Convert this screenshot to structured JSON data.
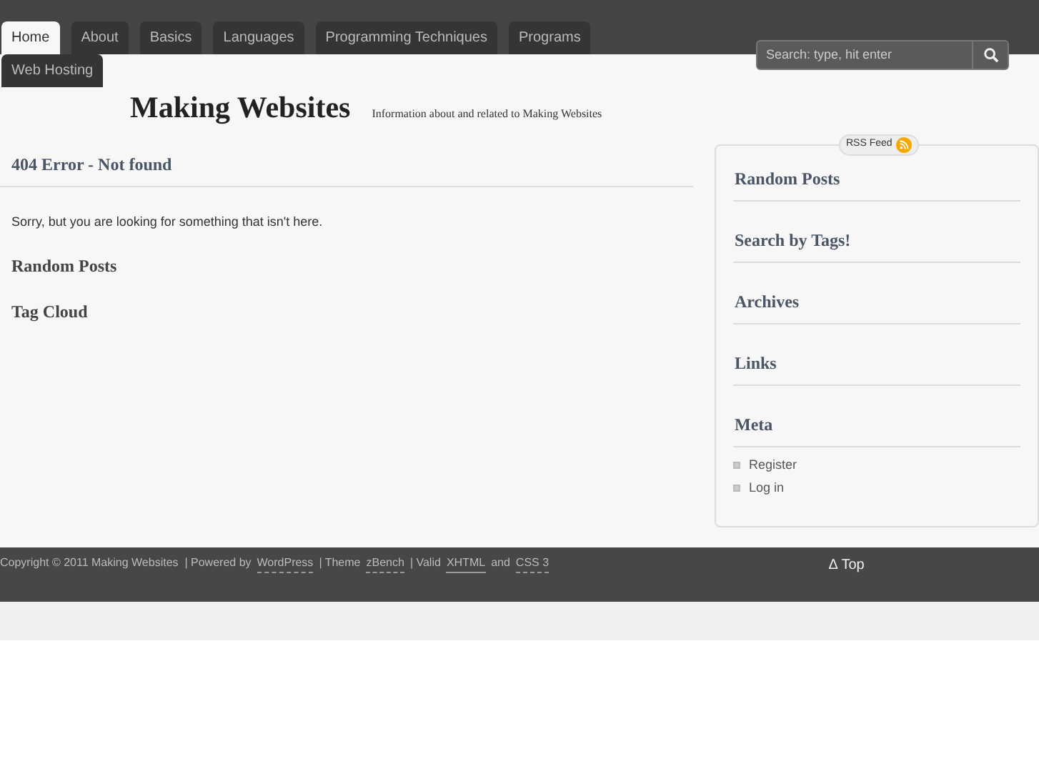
{
  "tabs": [
    {
      "label": "Home",
      "selected": true
    },
    {
      "label": "About",
      "selected": false
    },
    {
      "label": "Basics",
      "selected": false
    },
    {
      "label": "Languages",
      "selected": false
    },
    {
      "label": "Programming Techniques",
      "selected": false
    },
    {
      "label": "Programs",
      "selected": false
    },
    {
      "label": "Web Hosting",
      "selected": false
    }
  ],
  "search": {
    "placeholder": "Search: type, hit enter"
  },
  "site": {
    "title": "Making Websites",
    "tagline": "Information about and related to Making Websites"
  },
  "main": {
    "title": "404 Error - Not found",
    "message": "Sorry, but you are looking for something that isn't here.",
    "sections": [
      "Random Posts",
      "Tag Cloud"
    ]
  },
  "sidebar": {
    "rss": "RSS Feed",
    "widgets": [
      {
        "title": "Random Posts"
      },
      {
        "title": "Search by Tags!"
      },
      {
        "title": "Archives"
      },
      {
        "title": "Links"
      },
      {
        "title": "Meta",
        "items": [
          "Register",
          "Log in"
        ]
      }
    ]
  },
  "footer": {
    "parts": [
      {
        "kind": "text",
        "text": "Copyright © 2011 Making Websites  | Powered by"
      },
      {
        "kind": "link",
        "text": "WordPress"
      },
      {
        "kind": "text",
        "text": "| Theme"
      },
      {
        "kind": "link",
        "text": "zBench"
      },
      {
        "kind": "text",
        "text": "| Valid"
      },
      {
        "kind": "abbr",
        "text": "XHTML"
      },
      {
        "kind": "text",
        "text": "and"
      },
      {
        "kind": "link",
        "text": "CSS 3"
      }
    ],
    "top": "∆ Top"
  }
}
